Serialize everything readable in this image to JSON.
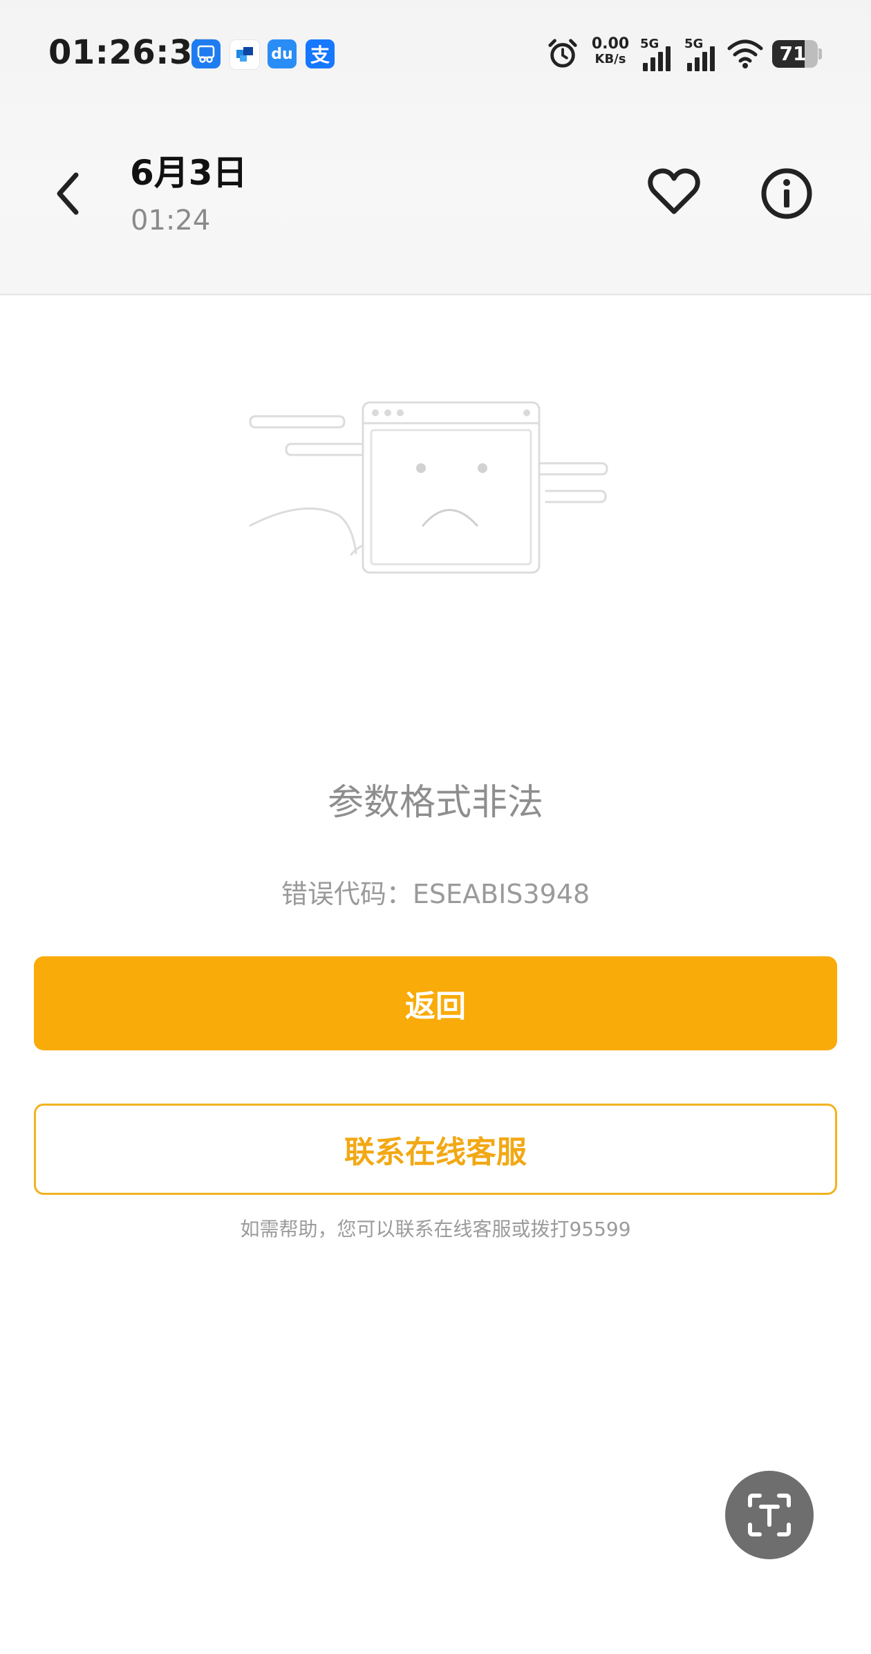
{
  "status_bar": {
    "time": "01:26:37",
    "apps": [
      {
        "icon": "app-scissors-icon",
        "glyph": "✂"
      },
      {
        "icon": "app-squares-icon",
        "glyph": ""
      },
      {
        "icon": "app-du-icon",
        "glyph": "du"
      },
      {
        "icon": "alipay-icon",
        "glyph": "支"
      }
    ],
    "net_speed_value": "0.00",
    "net_speed_unit": "KB/s",
    "signal_label_1": "5G",
    "signal_label_2": "5G",
    "battery": "71"
  },
  "header": {
    "title": "6月3日",
    "subtitle": "01:24"
  },
  "error": {
    "message": "参数格式非法",
    "code_text": "错误代码：ESEABIS3948"
  },
  "buttons": {
    "return_label": "返回",
    "service_label": "联系在线客服"
  },
  "help_text": "如需帮助，您可以联系在线客服或拨打95599",
  "colors": {
    "accent": "#f9ab09",
    "outline": "#f2b21f",
    "fab": "#6e6e6e"
  }
}
